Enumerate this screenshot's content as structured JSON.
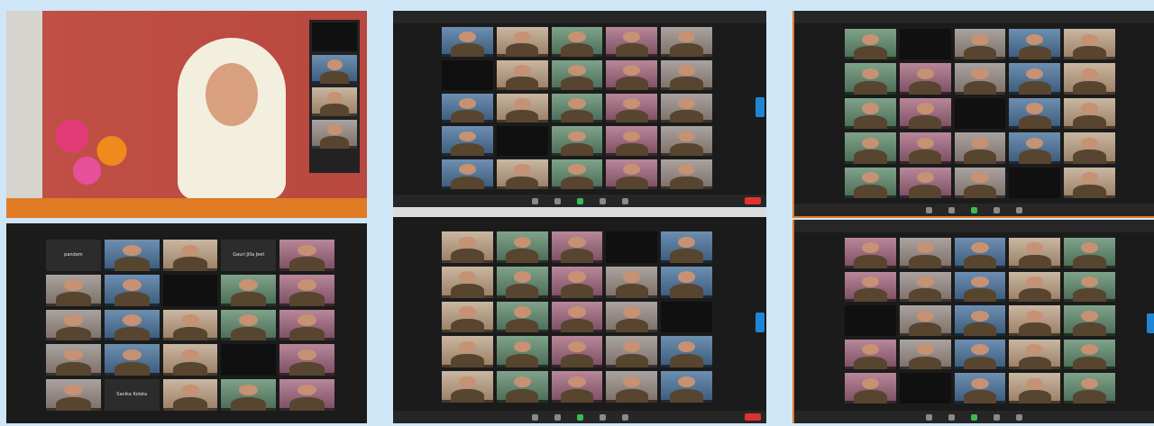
{
  "screens": [
    {
      "id": "speaker",
      "tiles": 4
    },
    {
      "id": "gallery-bottom-left",
      "cols": 5,
      "rows": 5,
      "labels": {
        "0": "pandam",
        "3": "Gauri Jilla Jeet",
        "21": "Sanika Kolata"
      }
    },
    {
      "id": "gallery-top-middle",
      "cols": 5,
      "rows": 5
    },
    {
      "id": "gallery-bottom-middle",
      "cols": 5,
      "rows": 5
    },
    {
      "id": "gallery-top-right",
      "cols": 5,
      "rows": 5
    },
    {
      "id": "gallery-bottom-right",
      "cols": 5,
      "rows": 5
    }
  ],
  "colors": {
    "background": "#cfe6f7",
    "end_meeting": "#e0322e",
    "video_on": "#3cba54",
    "arrow": "#1f86d6",
    "screen_border_orange": "#e07a24"
  }
}
